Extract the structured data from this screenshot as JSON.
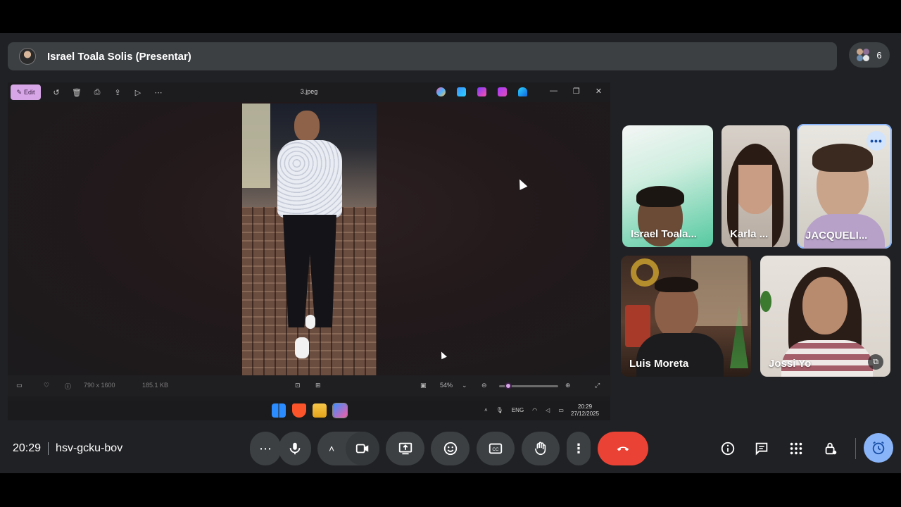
{
  "presenter_banner": {
    "title": "Israel Toala Solis (Presentar)"
  },
  "people_count": "6",
  "shared_screen": {
    "photos_app": {
      "edit_label": "Edit",
      "file_name": "3.jpeg",
      "dimensions": "790 x 1600",
      "file_size": "185.1 KB",
      "zoom": "54%",
      "zoom_fraction": 0.1
    },
    "windows_tray": {
      "language": "ENG",
      "time": "20:29",
      "date": "27/12/2025"
    }
  },
  "participants": [
    {
      "name": "Israel Toala..."
    },
    {
      "name": "Karla ..."
    },
    {
      "name": "JACQUELI..."
    },
    {
      "name": "Luis Moreta"
    },
    {
      "name": "Jossi Yo"
    }
  ],
  "meeting": {
    "time": "20:29",
    "code": "hsv-gcku-bov"
  },
  "icons": [
    "more-options-icon",
    "mic-icon",
    "chevron-up-icon",
    "camera-icon",
    "present-icon",
    "emoji-icon",
    "captions-icon",
    "raise-hand-icon",
    "more-vert-icon",
    "hang-up-icon",
    "info-icon",
    "chat-icon",
    "activities-icon",
    "host-controls-icon",
    "timer-icon"
  ],
  "colors": {
    "hangup": "#ea4335",
    "accent": "#8ab4f8",
    "edit": "#d7a6e6"
  }
}
